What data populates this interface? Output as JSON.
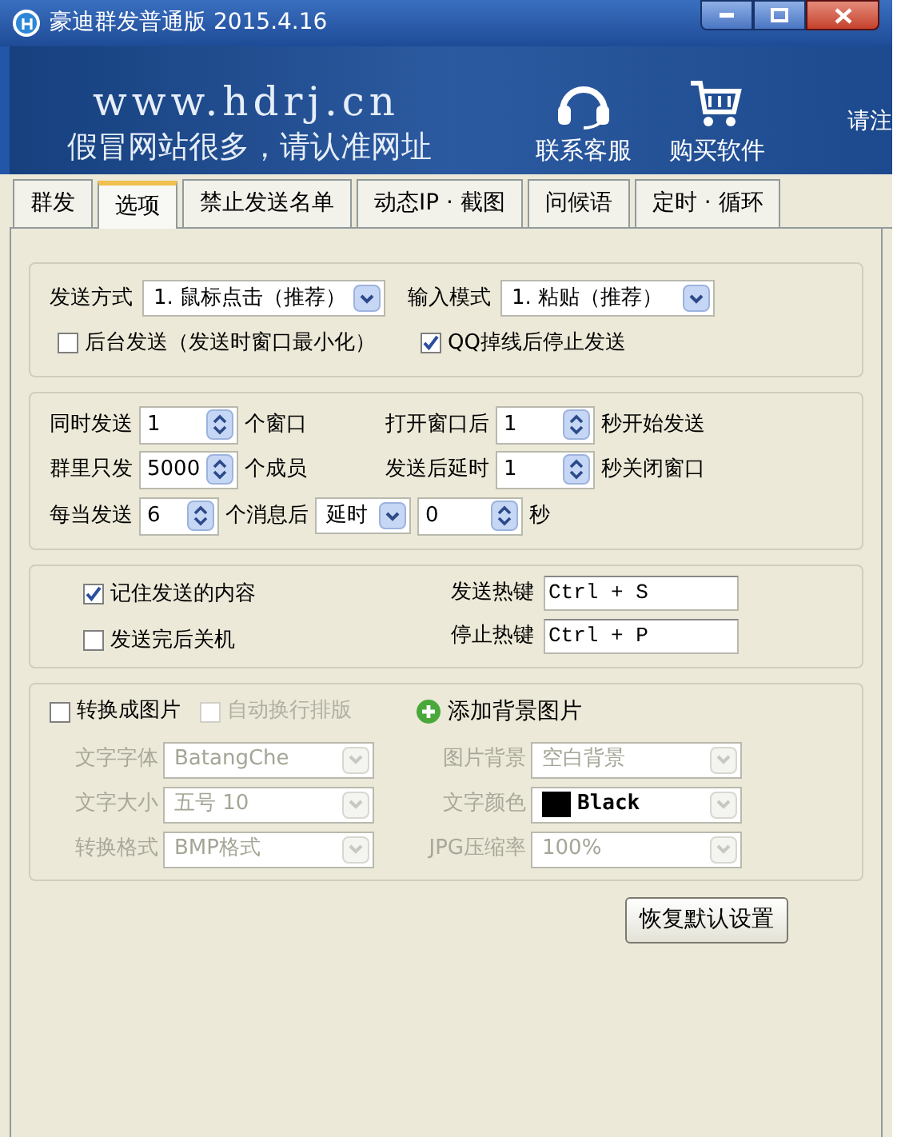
{
  "window": {
    "title": "豪迪群发普通版 2015.4.16"
  },
  "banner": {
    "url": "www.hdrj.cn",
    "slogan": "假冒网站很多，请认准网址",
    "links": [
      {
        "kind": "support",
        "label": "联系客服"
      },
      {
        "kind": "cart",
        "label": "购买软件"
      }
    ],
    "cut_text": "请注"
  },
  "tabs": [
    {
      "label": "群发",
      "selected": false
    },
    {
      "label": "选项",
      "selected": true
    },
    {
      "label": "禁止发送名单",
      "selected": false
    },
    {
      "label": "动态IP · 截图",
      "selected": false
    },
    {
      "label": "问候语",
      "selected": false
    },
    {
      "label": "定时 · 循环",
      "selected": false
    }
  ],
  "send_group": {
    "combos": [
      {
        "label": "发送方式",
        "value": "1. 鼠标点击（推荐）"
      },
      {
        "label": "输入模式",
        "value": "1. 粘贴（推荐）"
      }
    ],
    "checkboxes": [
      {
        "label": "后台发送（发送时窗口最小化）",
        "checked": false
      },
      {
        "label": "QQ掉线后停止发送",
        "checked": true
      }
    ]
  },
  "count_group": {
    "counters": [
      {
        "label": "同时发送",
        "value": "1",
        "unit": "个窗口"
      },
      {
        "label": "打开窗口后",
        "value": "1",
        "unit": "秒开始发送"
      },
      {
        "label": "群里只发",
        "value": "5000",
        "unit": "个成员"
      },
      {
        "label": "发送后延时",
        "value": "1",
        "unit": "秒关闭窗口"
      }
    ],
    "pause": {
      "label": "每当发送",
      "count": "6",
      "unit": "个消息后",
      "mode": "延时",
      "delay": "0",
      "delay_unit": "秒"
    }
  },
  "hotkey_group": {
    "checkboxes": [
      {
        "label": "记住发送的内容",
        "checked": true
      },
      {
        "label": "发送完后关机",
        "checked": false
      }
    ],
    "hotkeys": [
      {
        "label": "发送热键",
        "value": "Ctrl + S"
      },
      {
        "label": "停止热键",
        "value": "Ctrl + P"
      }
    ]
  },
  "image_group": {
    "checkboxes": [
      {
        "label": "转换成图片",
        "checked": false,
        "disabled": false
      },
      {
        "label": "自动换行排版",
        "checked": false,
        "disabled": true
      }
    ],
    "add_background": "添加背景图片",
    "settings": [
      {
        "label": "文字字体",
        "value": "BatangChe",
        "disabled": true
      },
      {
        "label": "图片背景",
        "value": "空白背景",
        "disabled": true
      },
      {
        "label": "文字大小",
        "value": "五号 10",
        "disabled": true
      },
      {
        "label": "文字颜色",
        "value": "Black",
        "color": "#000000",
        "disabled": true
      },
      {
        "label": "转换格式",
        "value": "BMP格式",
        "disabled": true
      },
      {
        "label": "JPG压缩率",
        "value": "100%",
        "disabled": true
      }
    ]
  },
  "reset_button": "恢复默认设置"
}
